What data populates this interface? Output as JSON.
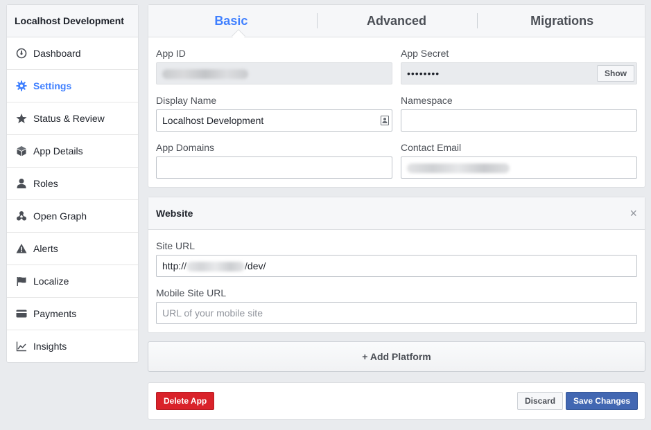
{
  "sidebar": {
    "title": "Localhost Development",
    "items": [
      {
        "label": "Dashboard",
        "icon": "dashboard-icon"
      },
      {
        "label": "Settings",
        "icon": "gear-icon"
      },
      {
        "label": "Status & Review",
        "icon": "star-icon"
      },
      {
        "label": "App Details",
        "icon": "cube-icon"
      },
      {
        "label": "Roles",
        "icon": "person-icon"
      },
      {
        "label": "Open Graph",
        "icon": "graph-icon"
      },
      {
        "label": "Alerts",
        "icon": "warning-icon"
      },
      {
        "label": "Localize",
        "icon": "flag-icon"
      },
      {
        "label": "Payments",
        "icon": "card-icon"
      },
      {
        "label": "Insights",
        "icon": "chart-icon"
      }
    ],
    "active_index": 1
  },
  "tabs": [
    {
      "label": "Basic"
    },
    {
      "label": "Advanced"
    },
    {
      "label": "Migrations"
    }
  ],
  "basic": {
    "app_id_label": "App ID",
    "app_secret_label": "App Secret",
    "app_secret_value": "••••••••",
    "show_label": "Show",
    "display_name_label": "Display Name",
    "display_name_value": "Localhost Development",
    "namespace_label": "Namespace",
    "namespace_value": "",
    "app_domains_label": "App Domains",
    "app_domains_value": "",
    "contact_email_label": "Contact Email"
  },
  "website": {
    "title": "Website",
    "close_glyph": "×",
    "site_url_label": "Site URL",
    "site_url_prefix": "http://",
    "site_url_suffix": "/dev/",
    "mobile_site_url_label": "Mobile Site URL",
    "mobile_site_url_placeholder": "URL of your mobile site"
  },
  "add_platform_label": "+ Add Platform",
  "actions": {
    "delete_label": "Delete App",
    "discard_label": "Discard",
    "save_label": "Save Changes"
  },
  "colors": {
    "accent": "#4080ff",
    "delete": "#d9222a",
    "save": "#4267b2"
  }
}
